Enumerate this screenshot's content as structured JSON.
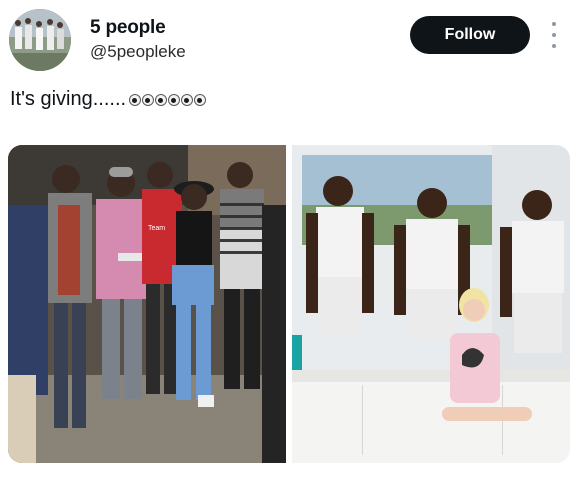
{
  "user": {
    "display_name": "5 people",
    "handle": "@5peopleke"
  },
  "follow_label": "Follow",
  "tweet": {
    "text": "It's giving......",
    "emoji_icons": [
      "eyes-icon",
      "eyes-icon",
      "eyes-icon"
    ]
  },
  "photos": [
    {
      "name": "photo-group-street",
      "shirt_text": "Team"
    },
    {
      "name": "photo-group-indoor"
    }
  ],
  "colors": {
    "follow_bg": "#0f1419",
    "text": "#0f1419",
    "secondary": "#536471"
  }
}
